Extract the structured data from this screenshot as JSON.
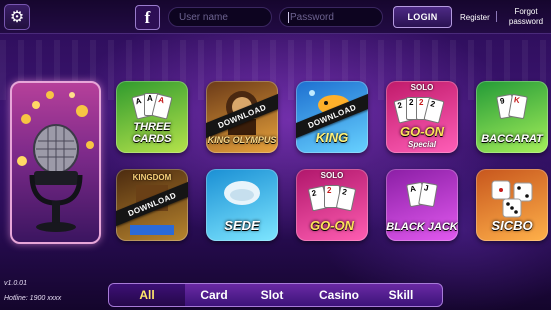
{
  "header": {
    "username_placeholder": "User name",
    "password_placeholder": "Password",
    "login_label": "LOGIN",
    "register_label": "Register",
    "forgot_label": "Forgot password"
  },
  "games": [
    {
      "id": "three-cards",
      "title": "THREE CARDS",
      "download": "",
      "solo": "",
      "colors": [
        "#2f9a2e",
        "#b6e34b"
      ]
    },
    {
      "id": "king-olympus",
      "title": "KING OLYMPUS",
      "download": "DOWNLOAD",
      "solo": "",
      "colors": [
        "#6b3a18",
        "#e8a33c"
      ]
    },
    {
      "id": "king",
      "title": "KING",
      "download": "DOWNLOAD",
      "solo": "",
      "colors": [
        "#1d6fd0",
        "#68d2ff"
      ]
    },
    {
      "id": "go-on-special",
      "title": "GO-ON",
      "subtitle": "Special",
      "download": "",
      "solo": "SOLO",
      "colors": [
        "#c01a6a",
        "#ff5fb8"
      ]
    },
    {
      "id": "baccarat",
      "title": "BACCARAT",
      "download": "",
      "solo": "",
      "colors": [
        "#239a37",
        "#a5ef5a"
      ]
    },
    {
      "id": "kingdom",
      "title": "KINGDOM",
      "download": "DOWNLOAD",
      "solo": "",
      "colors": [
        "#4b2a0f",
        "#b8852e"
      ]
    },
    {
      "id": "sede",
      "title": "SEDE",
      "download": "",
      "solo": "",
      "colors": [
        "#1a8fd4",
        "#7ee6ff"
      ]
    },
    {
      "id": "go-on",
      "title": "GO-ON",
      "download": "",
      "solo": "SOLO",
      "colors": [
        "#b0166b",
        "#ff5eb2"
      ]
    },
    {
      "id": "black-jack",
      "title": "BLACK JACK",
      "download": "",
      "solo": "",
      "colors": [
        "#8b1ea5",
        "#e25af0"
      ]
    },
    {
      "id": "sicbo",
      "title": "SICBO",
      "download": "",
      "solo": "",
      "colors": [
        "#c7561d",
        "#ffb14a"
      ]
    }
  ],
  "nav": {
    "tabs": [
      {
        "label": "All",
        "active": true
      },
      {
        "label": "Card",
        "active": false
      },
      {
        "label": "Slot",
        "active": false
      },
      {
        "label": "Casino",
        "active": false
      },
      {
        "label": "Skill",
        "active": false
      }
    ]
  },
  "footer": {
    "version": "v1.0.01",
    "hotline": "Hotline: 1900 xxxx"
  },
  "icons": {
    "settings": "gear-icon",
    "facebook": "facebook-icon",
    "featured": "microphone-icon"
  }
}
